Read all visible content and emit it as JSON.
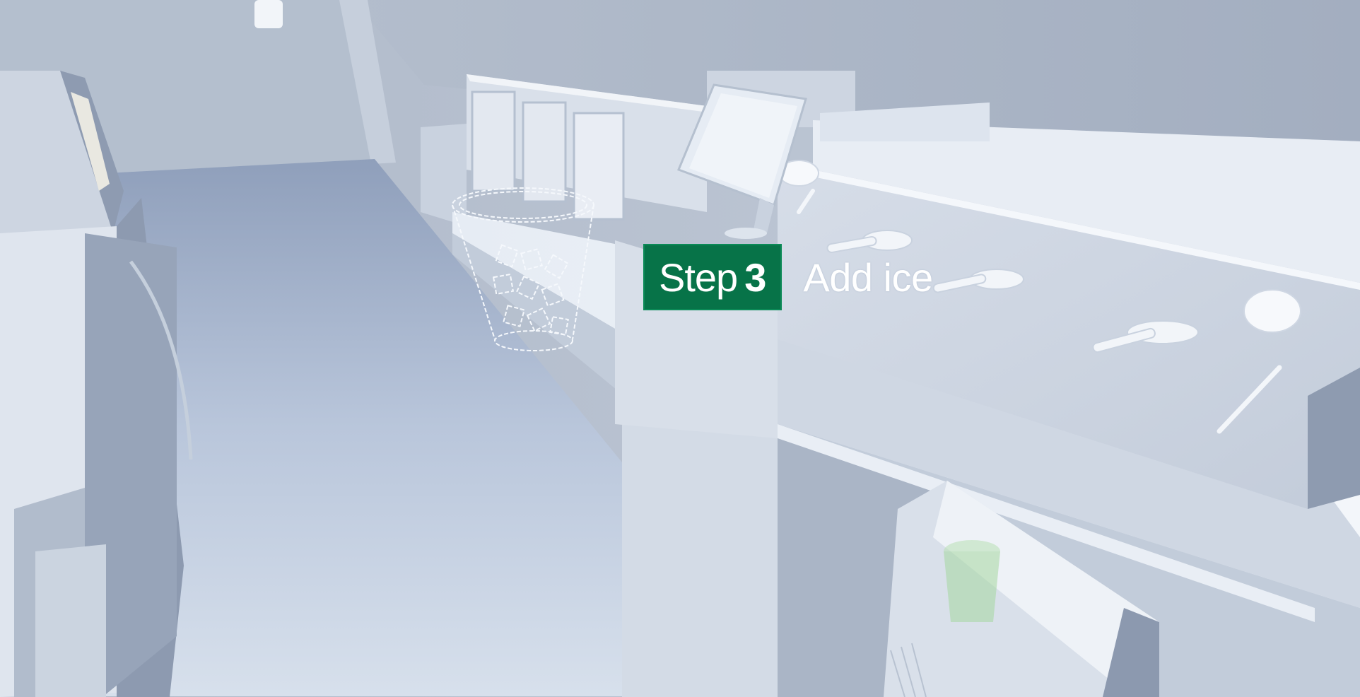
{
  "instruction": {
    "step_word": "Step",
    "step_number": "3",
    "text": "Add ice"
  },
  "colors": {
    "step_badge": "#077348",
    "scene_base": "#c9d3e2"
  },
  "scene_objects": [
    "ice-bucket-hologram",
    "espresso-machine",
    "pos-monitor",
    "refrigerator",
    "cup-hologram",
    "under-counter-fridge"
  ]
}
